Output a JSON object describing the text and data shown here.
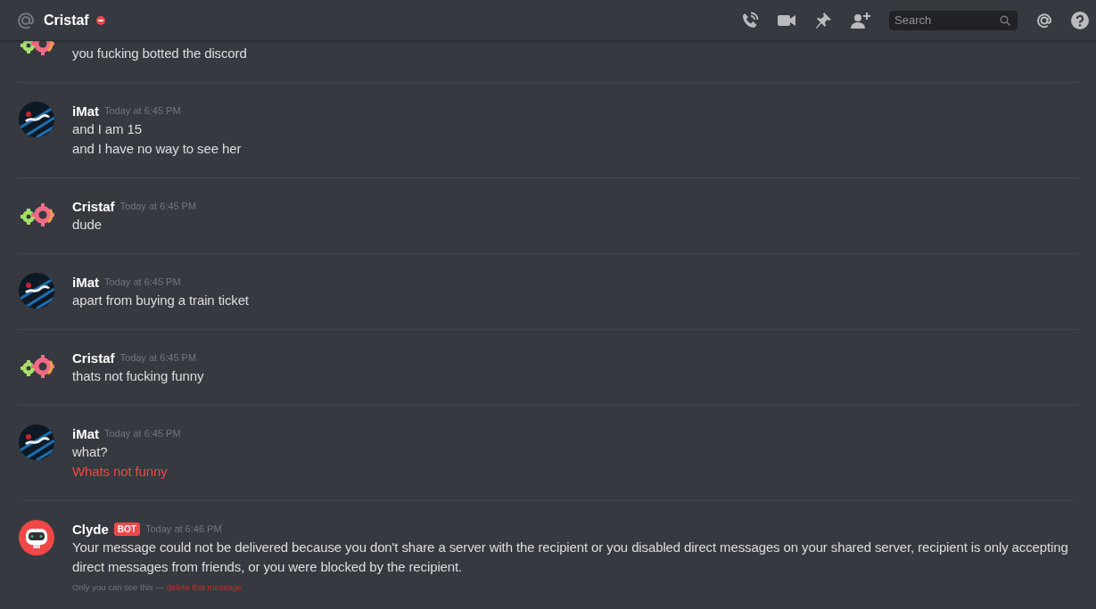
{
  "header": {
    "title": "Cristaf",
    "status": {
      "kind": "dnd"
    },
    "search": {
      "placeholder": "Search"
    }
  },
  "groups": [
    {
      "avatar": {
        "kind": "gears"
      },
      "lines": [
        {
          "text": "you fucking botted the discord",
          "failed": false
        }
      ]
    },
    {
      "avatar": {
        "kind": "scribble"
      },
      "author": "iMat",
      "timestamp": "Today at 6:45 PM",
      "lines": [
        {
          "text": "and I am 15",
          "failed": false
        },
        {
          "text": "and I have no way to see her",
          "failed": false
        }
      ]
    },
    {
      "avatar": {
        "kind": "gears"
      },
      "author": "Cristaf",
      "timestamp": "Today at 6:45 PM",
      "lines": [
        {
          "text": "dude",
          "failed": false
        }
      ]
    },
    {
      "avatar": {
        "kind": "scribble"
      },
      "author": "iMat",
      "timestamp": "Today at 6:45 PM",
      "lines": [
        {
          "text": "apart from buying a train ticket",
          "failed": false
        }
      ]
    },
    {
      "avatar": {
        "kind": "gears"
      },
      "author": "Cristaf",
      "timestamp": "Today at 6:45 PM",
      "lines": [
        {
          "text": "thats not fucking funny",
          "failed": false
        }
      ]
    },
    {
      "avatar": {
        "kind": "scribble"
      },
      "author": "iMat",
      "timestamp": "Today at 6:45 PM",
      "lines": [
        {
          "text": "what?",
          "failed": false
        },
        {
          "text": "Whats not funny",
          "failed": true
        }
      ]
    },
    {
      "avatar": {
        "kind": "robot"
      },
      "author": "Clyde",
      "tag": "BOT",
      "timestamp": "Today at 6:46 PM",
      "lines": [
        {
          "text": "Your message could not be delivered because you don't share a server with the recipient or you disabled direct messages on your shared server, recipient is only accepting direct messages from friends, or you were blocked by the recipient.",
          "failed": false
        }
      ],
      "note": {
        "text": "Only you can see this — ",
        "link": "delete this message",
        "end": "."
      }
    }
  ]
}
